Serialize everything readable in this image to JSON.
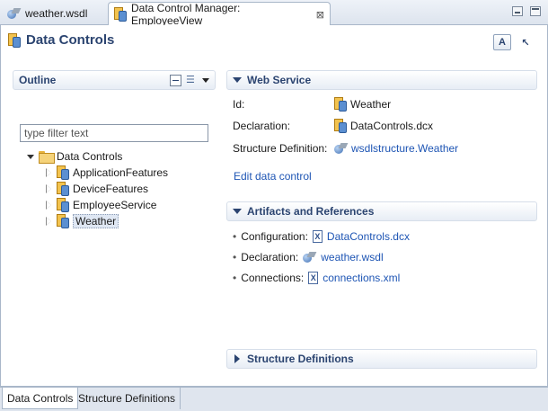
{
  "editor_tabs": [
    {
      "label": "weather.wsdl",
      "icon": "wsdl-file-icon",
      "active": false
    },
    {
      "label": "Data Control Manager: EmployeeView",
      "icon": "data-control-icon",
      "active": true,
      "close": "⊠"
    }
  ],
  "page": {
    "title": "Data Controls"
  },
  "outline": {
    "title": "Outline",
    "filter_placeholder": "type filter text",
    "root": "Data Controls",
    "items": [
      {
        "label": "ApplicationFeatures",
        "selected": false
      },
      {
        "label": "DeviceFeatures",
        "selected": false
      },
      {
        "label": "EmployeeService",
        "selected": false
      },
      {
        "label": "Weather",
        "selected": true
      }
    ]
  },
  "web_service": {
    "title": "Web Service",
    "id_label": "Id:",
    "id_value": "Weather",
    "declaration_label": "Declaration:",
    "declaration_value": "DataControls.dcx",
    "structure_label": "Structure Definition:",
    "structure_value": "wsdlstructure.Weather",
    "edit_link": "Edit data control"
  },
  "artifacts": {
    "title": "Artifacts and References",
    "configuration_label": "Configuration:",
    "configuration_value": "DataControls.dcx",
    "declaration_label": "Declaration:",
    "declaration_value": "weather.wsdl",
    "connections_label": "Connections:",
    "connections_value": "connections.xml"
  },
  "structure_definitions": {
    "title": "Structure Definitions"
  },
  "bottom_tabs": [
    {
      "label": "Data Controls",
      "active": true
    },
    {
      "label": "Structure Definitions",
      "active": false
    }
  ],
  "colors": {
    "header_text": "#2b4470",
    "link": "#1e55b4",
    "selection": "#dfe7f3"
  }
}
